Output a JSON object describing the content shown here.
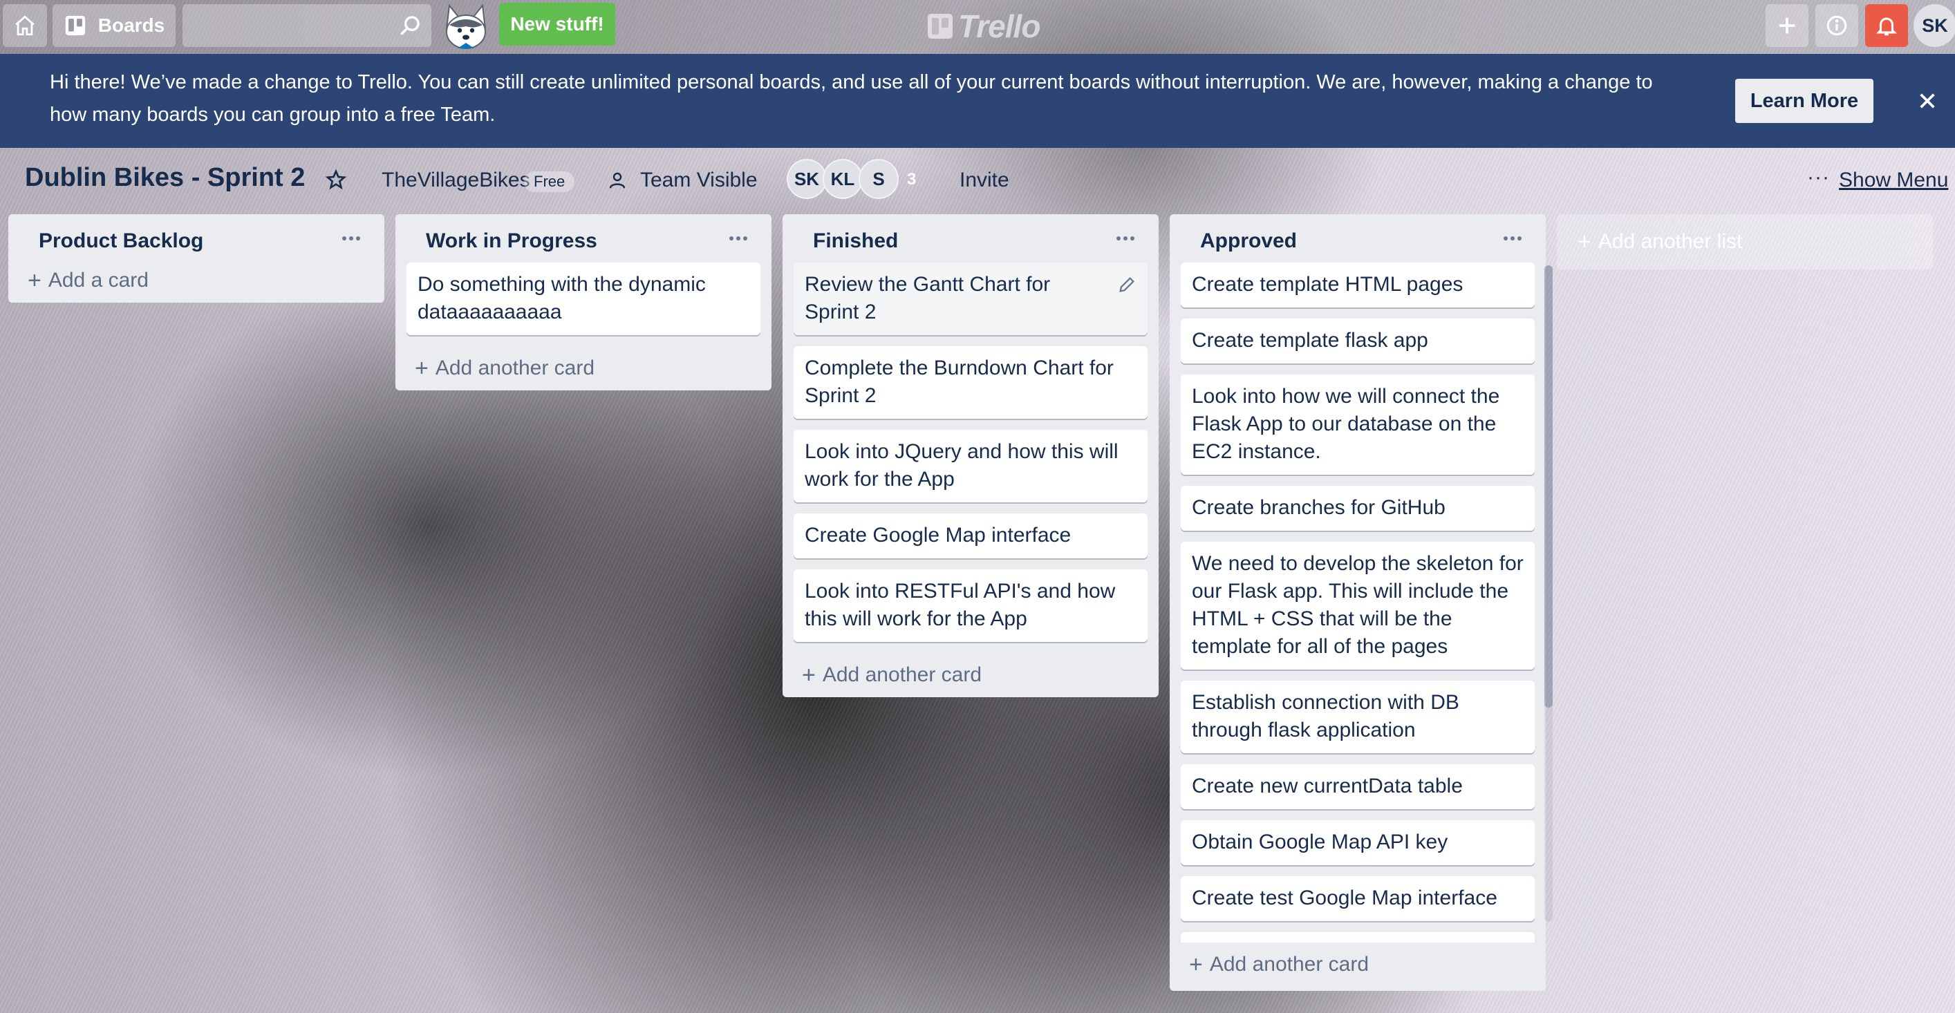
{
  "header": {
    "boards_label": "Boards",
    "search_value": "",
    "new_stuff_label": "New stuff!",
    "logo_text": "Trello",
    "user_initials": "SK"
  },
  "banner": {
    "message": "Hi there! We’ve made a change to Trello. You can still create unlimited personal boards, and use all of your current boards without interruption. We are, however, making a change to how many boards you can group into a free Team.",
    "learn_more_label": "Learn More"
  },
  "board": {
    "title": "Dublin Bikes - Sprint 2",
    "team": "TheVillageBikes",
    "plan_badge": "Free",
    "visibility": "Team Visible",
    "members": [
      "SK",
      "KL",
      "S"
    ],
    "member_count": "3",
    "invite_label": "Invite",
    "show_menu_label": "Show Menu"
  },
  "lists": [
    {
      "name": "Product Backlog",
      "cards": [],
      "add_label": "Add a card"
    },
    {
      "name": "Work in Progress",
      "cards": [
        "Do something with the dynamic dataaaaaaaaaa"
      ],
      "add_label": "Add another card"
    },
    {
      "name": "Finished",
      "cards": [
        "Review the Gantt Chart for Sprint 2",
        "Complete the Burndown Chart for Sprint 2",
        "Look into JQuery and how this will work for the App",
        "Create Google Map interface",
        "Look into RESTFul API's and how this will work for the App"
      ],
      "add_label": "Add another card"
    },
    {
      "name": "Approved",
      "cards": [
        "Create template HTML pages",
        "Create template flask app",
        "Look into how we will connect the Flask App to our database on the EC2 instance.",
        "Create branches for GitHub",
        "We need to develop the skeleton for our Flask app. This will include the HTML + CSS that will be the template for all of the pages",
        "Establish connection with DB through flask application",
        "Create new currentData table",
        "Obtain Google Map API key",
        "Create test Google Map interface",
        ""
      ],
      "add_label": "Add another card"
    }
  ],
  "add_list_label": "Add another list",
  "colors": {
    "banner": "#2c4574",
    "new_stuff": "#61bd4f",
    "notification": "#eb5a46",
    "list_bg": "#ebecf0"
  },
  "icons": [
    "home-icon",
    "boards-icon",
    "search-icon",
    "plus-icon",
    "info-icon",
    "bell-icon",
    "close-icon",
    "star-icon",
    "team-visible-icon",
    "edit-icon",
    "list-menu-icon"
  ]
}
